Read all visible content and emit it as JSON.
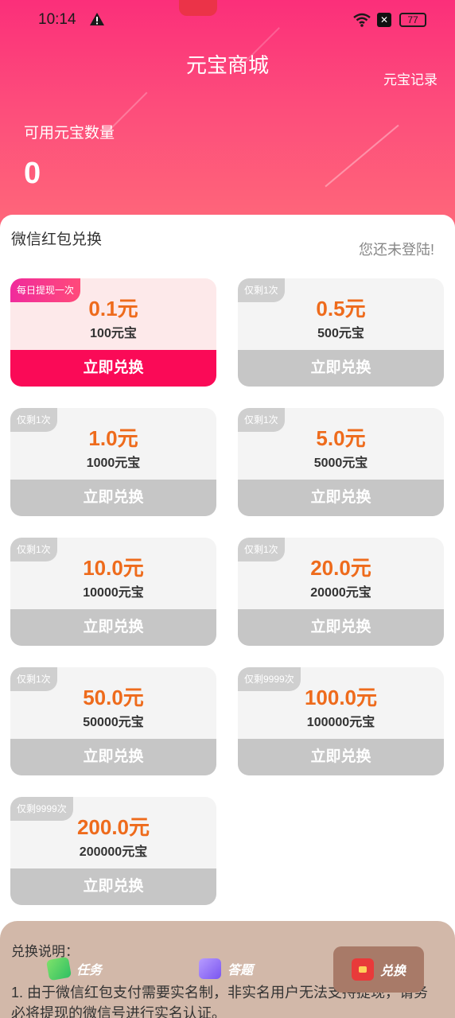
{
  "status_bar": {
    "time": "10:14",
    "battery": "77"
  },
  "header": {
    "title": "元宝商城",
    "record_link": "元宝记录",
    "available_label": "可用元宝数量",
    "available_value": "0"
  },
  "exchange": {
    "section_title": "微信红包兑换",
    "login_hint": "您还未登陆!",
    "cards": [
      {
        "tag": "每日提现一次",
        "price": "0.1元",
        "amount": "100元宝",
        "button": "立即兑换",
        "active": true
      },
      {
        "tag": "仅剩1次",
        "price": "0.5元",
        "amount": "500元宝",
        "button": "立即兑换",
        "active": false
      },
      {
        "tag": "仅剩1次",
        "price": "1.0元",
        "amount": "1000元宝",
        "button": "立即兑换",
        "active": false
      },
      {
        "tag": "仅剩1次",
        "price": "5.0元",
        "amount": "5000元宝",
        "button": "立即兑换",
        "active": false
      },
      {
        "tag": "仅剩1次",
        "price": "10.0元",
        "amount": "10000元宝",
        "button": "立即兑换",
        "active": false
      },
      {
        "tag": "仅剩1次",
        "price": "20.0元",
        "amount": "20000元宝",
        "button": "立即兑换",
        "active": false
      },
      {
        "tag": "仅剩1次",
        "price": "50.0元",
        "amount": "50000元宝",
        "button": "立即兑换",
        "active": false
      },
      {
        "tag": "仅剩9999次",
        "price": "100.0元",
        "amount": "100000元宝",
        "button": "立即兑换",
        "active": false
      },
      {
        "tag": "仅剩9999次",
        "price": "200.0元",
        "amount": "200000元宝",
        "button": "立即兑换",
        "active": false
      }
    ]
  },
  "notes": {
    "title": "兑换说明：",
    "line1": "1. 由于微信红包支付需要实名制，非实名用户无法支持提现，请务必将提现的微信号进行实名认证。"
  },
  "bottom_nav": {
    "task": "任务",
    "quiz": "答题",
    "exchange": "兑换"
  },
  "colors": {
    "header_gradient_top": "#fb2f7a",
    "active_button": "#fa0a57",
    "price_orange": "#ee6b1c",
    "disabled_button": "#c6c6c6"
  }
}
